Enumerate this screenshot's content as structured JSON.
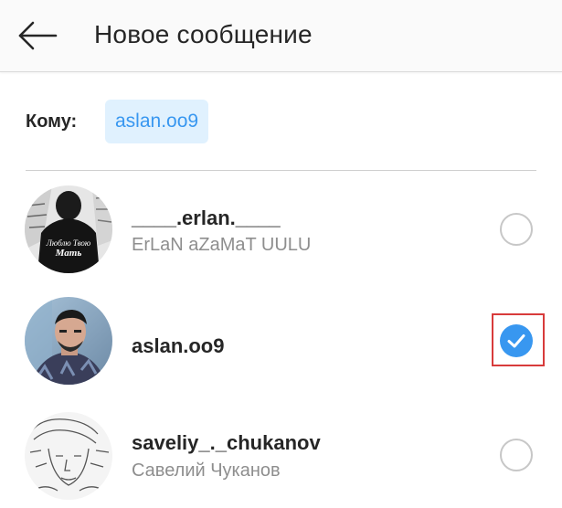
{
  "header": {
    "title": "Новое сообщение",
    "back_icon": "arrow-left-icon"
  },
  "recipient": {
    "label": "Кому:",
    "chip": "aslan.oo9"
  },
  "users": [
    {
      "username": "____.erlan.____",
      "full_name": "ErLaN aZaMaT UULU",
      "avatar_text": [
        "Люблю Твою",
        "Мать"
      ],
      "selected": false
    },
    {
      "username": "aslan.oo9",
      "full_name": "",
      "selected": true
    },
    {
      "username": "saveliy_._chukanov",
      "full_name": "Савелий Чуканов",
      "selected": false
    }
  ],
  "colors": {
    "accent": "#3897f0",
    "chip_bg": "#e0f1fe",
    "highlight": "#d83b3b"
  }
}
